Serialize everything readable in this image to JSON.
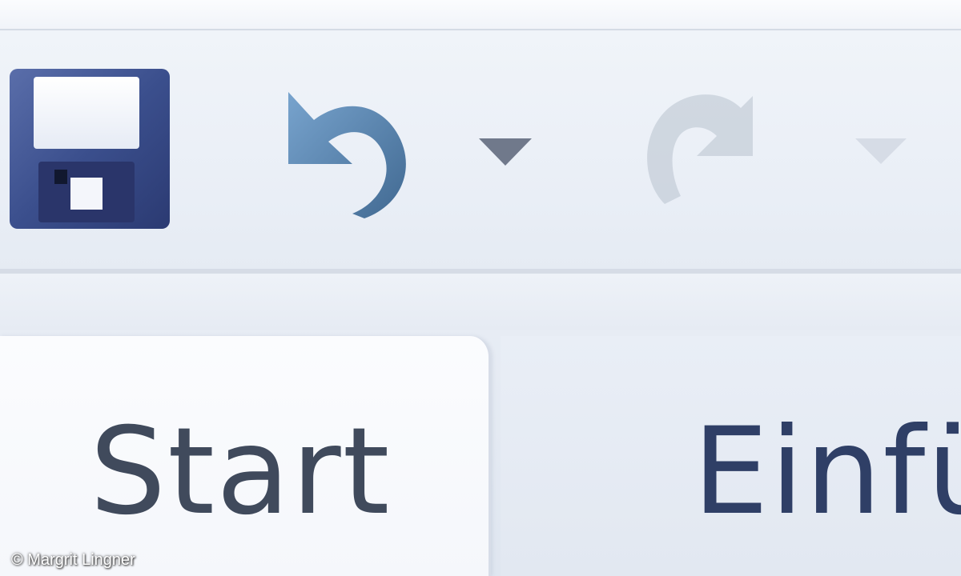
{
  "quick_access_toolbar": {
    "save_icon": "floppy-disk-icon",
    "undo_icon": "undo-arrow-icon",
    "undo_dropdown_icon": "chevron-down-icon",
    "redo_icon": "redo-arrow-icon",
    "redo_dropdown_icon": "chevron-down-icon",
    "redo_enabled": false
  },
  "ribbon": {
    "tabs": [
      {
        "label": "Start",
        "selected": true
      },
      {
        "label": "Einfü",
        "selected": false
      }
    ]
  },
  "credit": "© Margrit Lingner",
  "colors": {
    "toolbar_bg": "#e9eef6",
    "floppy_body": "#3a4f8e",
    "undo_arrow": "#3f6f9e",
    "tab_text": "#404a5c"
  }
}
